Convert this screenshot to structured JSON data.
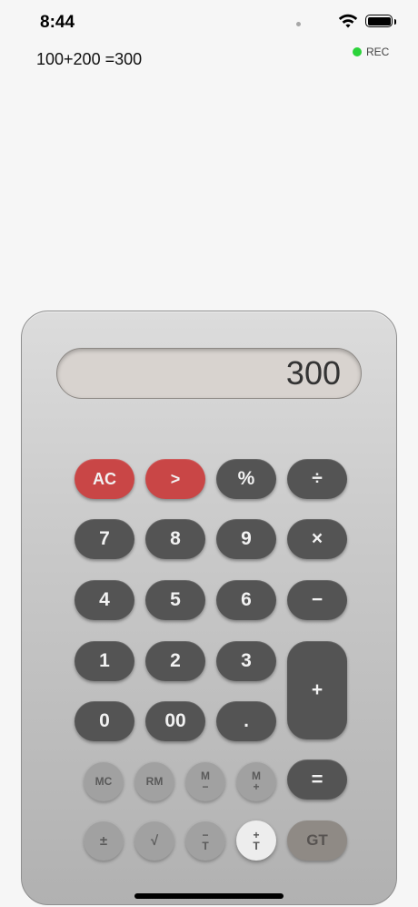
{
  "status": {
    "time": "8:44"
  },
  "history": {
    "text": "100+200 =300",
    "rec_label": "REC",
    "rec_color": "#2bd33a"
  },
  "display": {
    "value": "300"
  },
  "keys": {
    "ac": "AC",
    "back": ">",
    "percent": "%",
    "divide": "÷",
    "seven": "7",
    "eight": "8",
    "nine": "9",
    "multiply": "×",
    "four": "4",
    "five": "5",
    "six": "6",
    "minus": "−",
    "one": "1",
    "two": "2",
    "three": "3",
    "plus": "+",
    "zero": "0",
    "double_zero": "00",
    "dot": ".",
    "equals": "="
  },
  "memory_keys": {
    "mc": "MC",
    "rm": "RM",
    "m_minus_top": "M",
    "m_minus_bottom": "−",
    "m_plus_top": "M",
    "m_plus_bottom": "+",
    "sign": "±",
    "sqrt": "√",
    "t_minus_top": "−",
    "t_minus_bottom": "T",
    "t_plus_top": "+",
    "t_plus_bottom": "T",
    "gt": "GT"
  },
  "colors": {
    "key_dark": "#545454",
    "key_red": "#c94646",
    "display_bg": "#d8d3cf"
  },
  "icons": [
    "wifi-icon",
    "battery-icon"
  ]
}
